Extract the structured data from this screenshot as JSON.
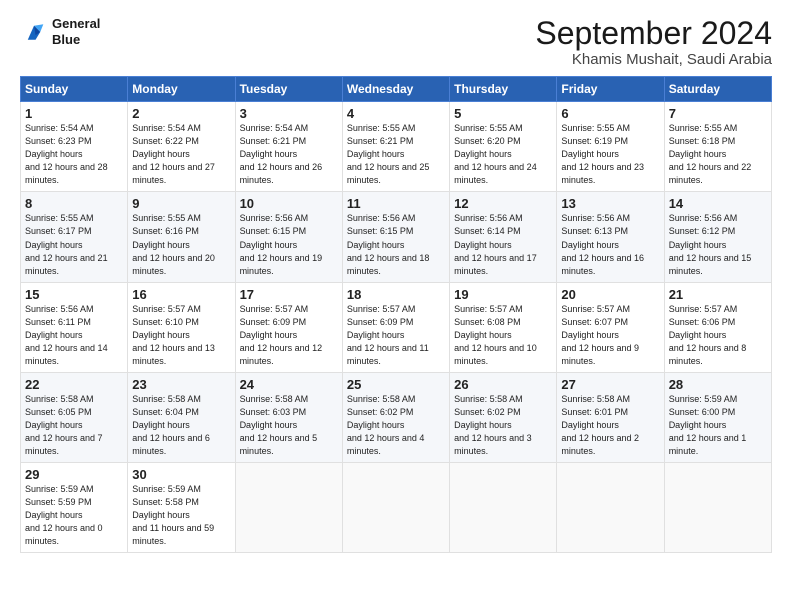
{
  "logo": {
    "line1": "General",
    "line2": "Blue"
  },
  "title": "September 2024",
  "subtitle": "Khamis Mushait, Saudi Arabia",
  "days_header": [
    "Sunday",
    "Monday",
    "Tuesday",
    "Wednesday",
    "Thursday",
    "Friday",
    "Saturday"
  ],
  "weeks": [
    [
      {
        "day": "1",
        "sunrise": "5:54 AM",
        "sunset": "6:23 PM",
        "daylight": "12 hours and 28 minutes."
      },
      {
        "day": "2",
        "sunrise": "5:54 AM",
        "sunset": "6:22 PM",
        "daylight": "12 hours and 27 minutes."
      },
      {
        "day": "3",
        "sunrise": "5:54 AM",
        "sunset": "6:21 PM",
        "daylight": "12 hours and 26 minutes."
      },
      {
        "day": "4",
        "sunrise": "5:55 AM",
        "sunset": "6:21 PM",
        "daylight": "12 hours and 25 minutes."
      },
      {
        "day": "5",
        "sunrise": "5:55 AM",
        "sunset": "6:20 PM",
        "daylight": "12 hours and 24 minutes."
      },
      {
        "day": "6",
        "sunrise": "5:55 AM",
        "sunset": "6:19 PM",
        "daylight": "12 hours and 23 minutes."
      },
      {
        "day": "7",
        "sunrise": "5:55 AM",
        "sunset": "6:18 PM",
        "daylight": "12 hours and 22 minutes."
      }
    ],
    [
      {
        "day": "8",
        "sunrise": "5:55 AM",
        "sunset": "6:17 PM",
        "daylight": "12 hours and 21 minutes."
      },
      {
        "day": "9",
        "sunrise": "5:55 AM",
        "sunset": "6:16 PM",
        "daylight": "12 hours and 20 minutes."
      },
      {
        "day": "10",
        "sunrise": "5:56 AM",
        "sunset": "6:15 PM",
        "daylight": "12 hours and 19 minutes."
      },
      {
        "day": "11",
        "sunrise": "5:56 AM",
        "sunset": "6:15 PM",
        "daylight": "12 hours and 18 minutes."
      },
      {
        "day": "12",
        "sunrise": "5:56 AM",
        "sunset": "6:14 PM",
        "daylight": "12 hours and 17 minutes."
      },
      {
        "day": "13",
        "sunrise": "5:56 AM",
        "sunset": "6:13 PM",
        "daylight": "12 hours and 16 minutes."
      },
      {
        "day": "14",
        "sunrise": "5:56 AM",
        "sunset": "6:12 PM",
        "daylight": "12 hours and 15 minutes."
      }
    ],
    [
      {
        "day": "15",
        "sunrise": "5:56 AM",
        "sunset": "6:11 PM",
        "daylight": "12 hours and 14 minutes."
      },
      {
        "day": "16",
        "sunrise": "5:57 AM",
        "sunset": "6:10 PM",
        "daylight": "12 hours and 13 minutes."
      },
      {
        "day": "17",
        "sunrise": "5:57 AM",
        "sunset": "6:09 PM",
        "daylight": "12 hours and 12 minutes."
      },
      {
        "day": "18",
        "sunrise": "5:57 AM",
        "sunset": "6:09 PM",
        "daylight": "12 hours and 11 minutes."
      },
      {
        "day": "19",
        "sunrise": "5:57 AM",
        "sunset": "6:08 PM",
        "daylight": "12 hours and 10 minutes."
      },
      {
        "day": "20",
        "sunrise": "5:57 AM",
        "sunset": "6:07 PM",
        "daylight": "12 hours and 9 minutes."
      },
      {
        "day": "21",
        "sunrise": "5:57 AM",
        "sunset": "6:06 PM",
        "daylight": "12 hours and 8 minutes."
      }
    ],
    [
      {
        "day": "22",
        "sunrise": "5:58 AM",
        "sunset": "6:05 PM",
        "daylight": "12 hours and 7 minutes."
      },
      {
        "day": "23",
        "sunrise": "5:58 AM",
        "sunset": "6:04 PM",
        "daylight": "12 hours and 6 minutes."
      },
      {
        "day": "24",
        "sunrise": "5:58 AM",
        "sunset": "6:03 PM",
        "daylight": "12 hours and 5 minutes."
      },
      {
        "day": "25",
        "sunrise": "5:58 AM",
        "sunset": "6:02 PM",
        "daylight": "12 hours and 4 minutes."
      },
      {
        "day": "26",
        "sunrise": "5:58 AM",
        "sunset": "6:02 PM",
        "daylight": "12 hours and 3 minutes."
      },
      {
        "day": "27",
        "sunrise": "5:58 AM",
        "sunset": "6:01 PM",
        "daylight": "12 hours and 2 minutes."
      },
      {
        "day": "28",
        "sunrise": "5:59 AM",
        "sunset": "6:00 PM",
        "daylight": "12 hours and 1 minute."
      }
    ],
    [
      {
        "day": "29",
        "sunrise": "5:59 AM",
        "sunset": "5:59 PM",
        "daylight": "12 hours and 0 minutes."
      },
      {
        "day": "30",
        "sunrise": "5:59 AM",
        "sunset": "5:58 PM",
        "daylight": "11 hours and 59 minutes."
      },
      null,
      null,
      null,
      null,
      null
    ]
  ]
}
